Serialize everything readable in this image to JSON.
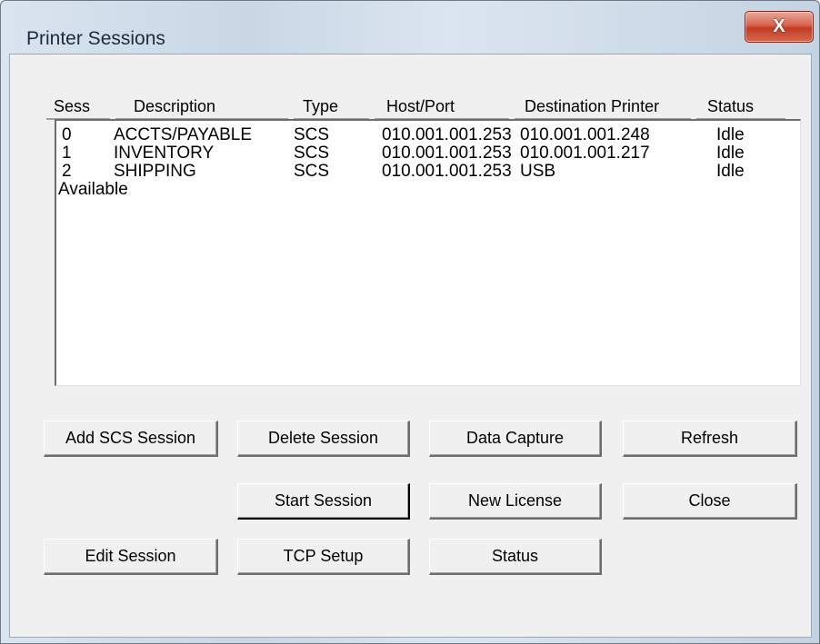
{
  "window": {
    "title": "Printer Sessions",
    "close_label": "X"
  },
  "list": {
    "columns": [
      "Sess",
      "Description",
      "Type",
      "Host/Port",
      "Destination Printer",
      "Status"
    ],
    "rows": [
      {
        "sess": "0",
        "description": "ACCTS/PAYABLE",
        "type": "SCS",
        "host": "010.001.001.253",
        "dest": "010.001.001.248",
        "status": "Idle"
      },
      {
        "sess": "1",
        "description": "INVENTORY",
        "type": "SCS",
        "host": "010.001.001.253",
        "dest": "010.001.001.217",
        "status": "Idle"
      },
      {
        "sess": "2",
        "description": "SHIPPING",
        "type": "SCS",
        "host": "010.001.001.253",
        "dest": "USB",
        "status": "Idle"
      }
    ],
    "available_label": "Available"
  },
  "buttons": {
    "add_scs_session": "Add SCS Session",
    "delete_session": "Delete Session",
    "data_capture": "Data Capture",
    "refresh": "Refresh",
    "start_session": "Start Session",
    "new_license": "New License",
    "close": "Close",
    "edit_session": "Edit Session",
    "tcp_setup": "TCP Setup",
    "status": "Status"
  }
}
